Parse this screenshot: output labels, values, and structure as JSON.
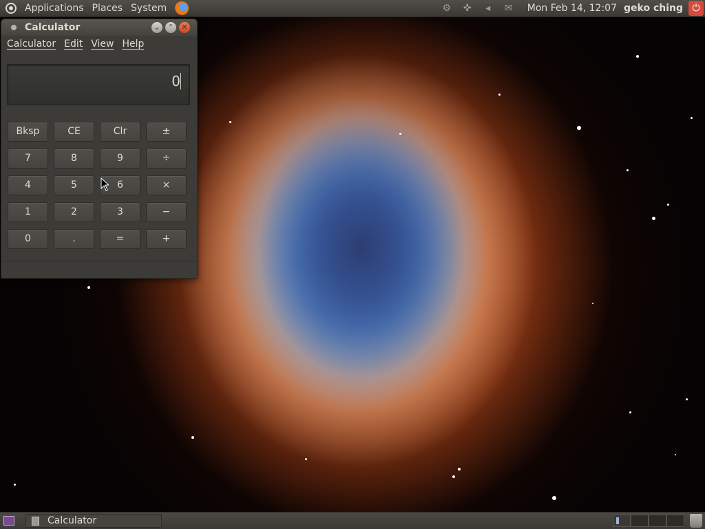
{
  "top_panel": {
    "menus": [
      "Applications",
      "Places",
      "System"
    ],
    "clock": "Mon Feb 14, 12:07",
    "username": "geko ching"
  },
  "calculator": {
    "title": "Calculator",
    "menus": [
      "Calculator",
      "Edit",
      "View",
      "Help"
    ],
    "display_value": "0",
    "keys": [
      [
        "Bksp",
        "CE",
        "Clr",
        "±"
      ],
      [
        "7",
        "8",
        "9",
        "÷"
      ],
      [
        "4",
        "5",
        "6",
        "×"
      ],
      [
        "1",
        "2",
        "3",
        "−"
      ],
      [
        "0",
        ".",
        "=",
        "+"
      ]
    ]
  },
  "bottom_panel": {
    "task_label": "Calculator"
  },
  "icons": {
    "ubuntu_logo": "ubuntu-logo-icon",
    "firefox": "firefox-icon",
    "network": "network-icon",
    "volume": "volume-icon",
    "mail": "mail-icon",
    "power": "power-icon",
    "trash": "trash-icon"
  }
}
